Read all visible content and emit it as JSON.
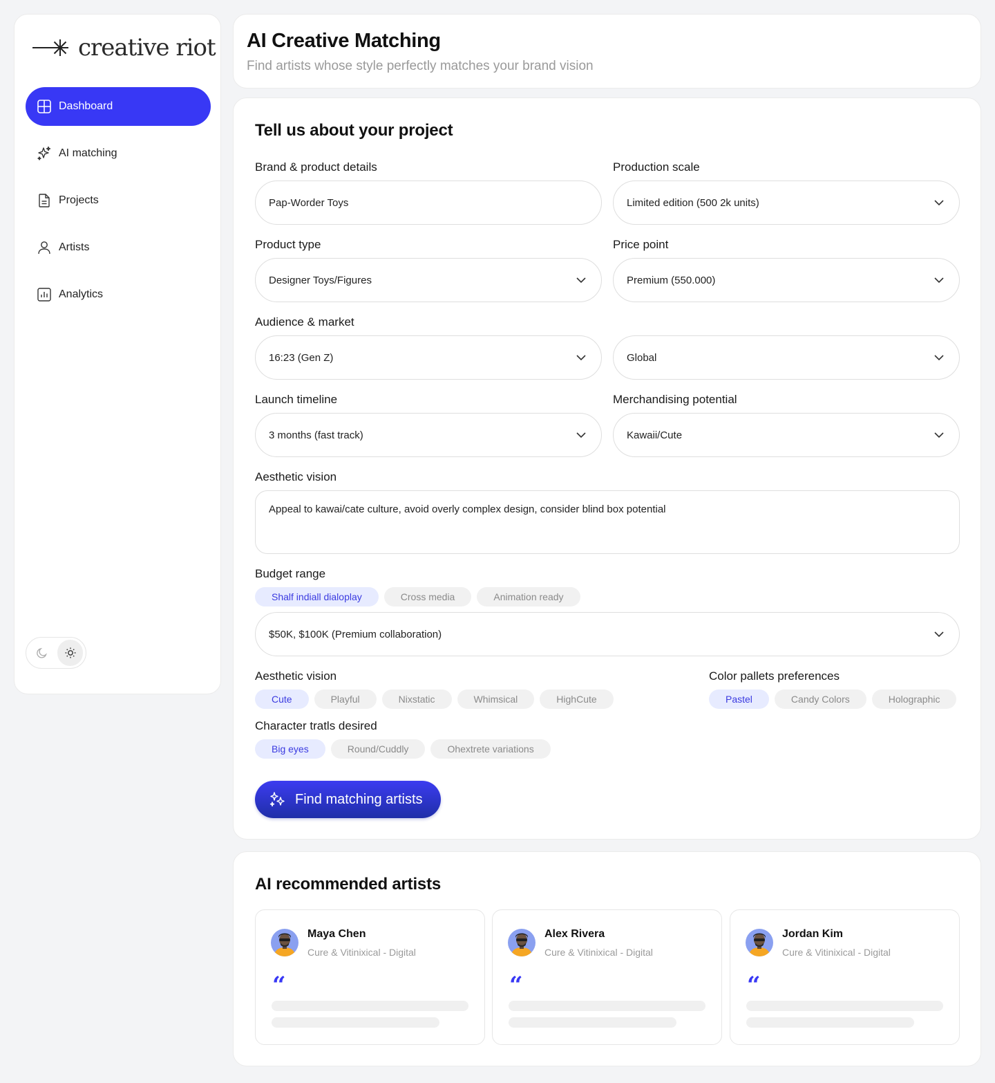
{
  "brand": {
    "name": "creative riot"
  },
  "nav": [
    {
      "label": "Dashboard",
      "icon": "dashboard-icon",
      "active": true
    },
    {
      "label": "AI matching",
      "icon": "sparkle-icon",
      "active": false
    },
    {
      "label": "Projects",
      "icon": "document-icon",
      "active": false
    },
    {
      "label": "Artists",
      "icon": "user-icon",
      "active": false
    },
    {
      "label": "Analytics",
      "icon": "chart-icon",
      "active": false
    }
  ],
  "theme": {
    "dark_icon": "moon-icon",
    "light_icon": "sun-icon",
    "selected": "light"
  },
  "header": {
    "title": "AI Creative Matching",
    "subtitle": "Find artists whose style perfectly matches your brand vision"
  },
  "form": {
    "title": "Tell us about your project",
    "brand_label": "Brand & product details",
    "brand_value": "Pap-Worder Toys",
    "scale_label": "Production scale",
    "scale_value": "Limited edition (500 2k units)",
    "product_label": "Product type",
    "product_value": "Designer Toys/Figures",
    "price_label": "Price point",
    "price_value": "Premium (550.000)",
    "audience_label": "Audience & market",
    "audience_value": "16:23 (Gen Z)",
    "market_value": "Global",
    "timeline_label": "Launch timeline",
    "timeline_value": "3 months (fast track)",
    "merch_label": "Merchandising potential",
    "merch_value": "Kawaii/Cute",
    "vision_label": "Aesthetic vision",
    "vision_value": "Appeal to kawai/cate culture, avoid overly complex design, consider blind box potential",
    "budget_label": "Budget range",
    "budget_chips": [
      {
        "label": "Shalf indiall dialoplay",
        "selected": true
      },
      {
        "label": "Cross media",
        "selected": false
      },
      {
        "label": "Animation ready",
        "selected": false
      }
    ],
    "budget_value": "$50K, $100K (Premium collaboration)",
    "aesthetic_label": "Aesthetic vision",
    "aesthetic_chips": [
      {
        "label": "Cute",
        "selected": true
      },
      {
        "label": "Playful",
        "selected": false
      },
      {
        "label": "Nixstatic",
        "selected": false
      },
      {
        "label": "Whimsical",
        "selected": false
      },
      {
        "label": "HighCute",
        "selected": false
      }
    ],
    "color_label": "Color pallets preferences",
    "color_chips": [
      {
        "label": "Pastel",
        "selected": true
      },
      {
        "label": "Candy Colors",
        "selected": false
      },
      {
        "label": "Holographic",
        "selected": false
      }
    ],
    "traits_label": "Character tratls desired",
    "traits_chips": [
      {
        "label": "Big eyes",
        "selected": true
      },
      {
        "label": "Round/Cuddly",
        "selected": false
      },
      {
        "label": "Ohextrete variations",
        "selected": false
      }
    ],
    "cta_label": "Find matching artists"
  },
  "recommendations": {
    "title": "AI recommended artists",
    "artists": [
      {
        "name": "Maya Chen",
        "meta": "Cure & Vitinixical - Digital",
        "quote": "“"
      },
      {
        "name": "Alex Rivera",
        "meta": "Cure & Vitinixical - Digital",
        "quote": "“"
      },
      {
        "name": "Jordan Kim",
        "meta": "Cure & Vitinixical - Digital",
        "quote": "“"
      }
    ]
  },
  "colors": {
    "accent": "#3838f5",
    "chip_selected_bg": "#e7ebff",
    "chip_bg": "#f1f1f1"
  }
}
